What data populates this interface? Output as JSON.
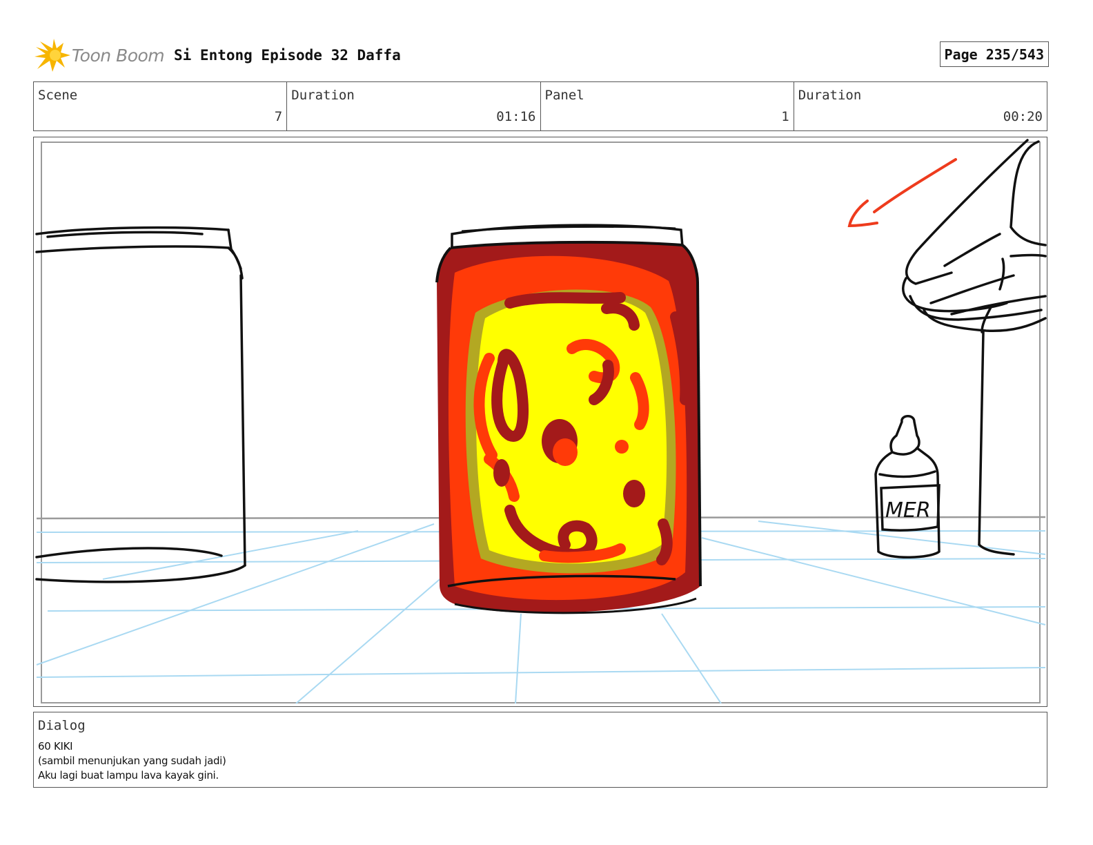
{
  "header": {
    "brand": "Toon Boom",
    "project_title": "Si Entong Episode 32 Daffa",
    "page": "Page 235/543"
  },
  "info": {
    "scene_label": "Scene",
    "scene_value": "7",
    "scene_duration_label": "Duration",
    "scene_duration_value": "01:16",
    "panel_label": "Panel",
    "panel_value": "1",
    "panel_duration_label": "Duration",
    "panel_duration_value": "00:20"
  },
  "panel": {
    "bottle_label": "MER"
  },
  "dialog": {
    "label": "Dialog",
    "lines": [
      "60 KIKI",
      "(sambil menunjukan yang sudah jadi)",
      "Aku lagi buat lampu lava kayak gini."
    ]
  },
  "colors": {
    "lava_dark": "#a31a1a",
    "lava_orange": "#ff3a08",
    "lava_yellow": "#ffff00",
    "lava_olive": "#b3a822",
    "floor_grid": "#a9d9f2",
    "arrow": "#ee3b1d",
    "logo_star": "#f7b500"
  }
}
